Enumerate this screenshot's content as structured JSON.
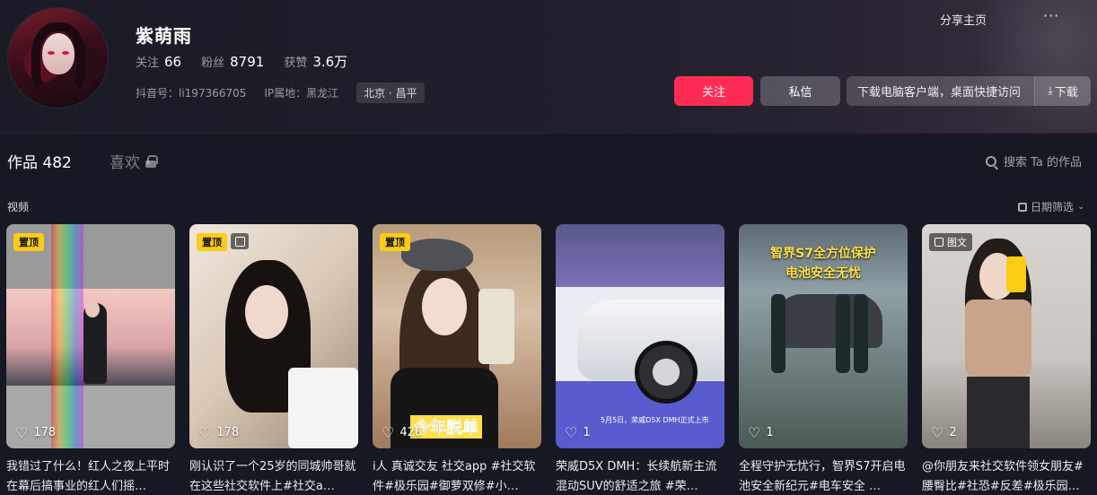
{
  "profile": {
    "nickname": "紫萌雨",
    "following_label": "关注",
    "following_count": "66",
    "fans_label": "粉丝",
    "fans_count": "8791",
    "likes_label": "获赞",
    "likes_count": "3.6万",
    "douyin_id": "抖音号：li197366705",
    "ip_location": "IP属地：黑龙江",
    "location_tag": "北京 · 昌平"
  },
  "header_actions": {
    "share_label": "分享主页",
    "more_label": "···",
    "follow_label": "关注",
    "message_label": "私信",
    "download_desc": "下载电脑客户端，桌面快捷访问",
    "download_label": "下载"
  },
  "tabs": {
    "works_label": "作品 482",
    "likes_label": "喜欢",
    "search_label": "搜索 Ta 的作品"
  },
  "section": {
    "title": "视频",
    "filter_label": "日期筛选"
  },
  "videos": [
    {
      "badge": "置顶",
      "likes": "178",
      "caption": "我错过了什么！红人之夜上平时在幕后搞事业的红人们摇…"
    },
    {
      "badge": "置顶",
      "likes": "178",
      "caption": "刚认识了一个25岁的同城帅哥就在这些社交软件上#社交a…"
    },
    {
      "badge": "置顶",
      "likes": "426",
      "caption": "i人 真诚交友 社交app #社交软件#极乐园#御萝双修#小…",
      "overlay": "今年脱单"
    },
    {
      "likes": "1",
      "caption": "荣威D5X DMH：长续航新主流混动SUV的舒适之旅 #荣…",
      "overlay": "5月5日，荣威D5X DMH正式上市"
    },
    {
      "likes": "1",
      "caption": "全程守护无忧行，智界S7开启电池安全新纪元#电车安全 …",
      "overlay_line1": "智界S7全方位保护",
      "overlay_line2": "电池安全无忧"
    },
    {
      "badge": "图文",
      "likes": "2",
      "caption": "@你朋友来社交软件领女朋友#腰臀比#社恐#反差#极乐园…"
    }
  ],
  "colors": {
    "background": "#161823",
    "accent": "#fe2c55",
    "pin_badge": "#facc15"
  }
}
